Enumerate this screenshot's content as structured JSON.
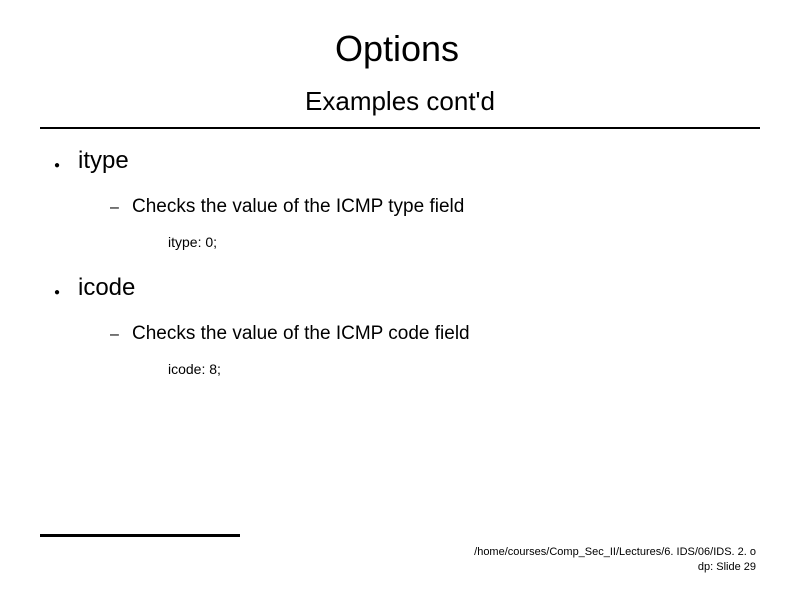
{
  "title": "Options",
  "subtitle": "Examples cont'd",
  "items": [
    {
      "name": "itype",
      "desc": "Checks the value of the ICMP type field",
      "code": "itype: 0;"
    },
    {
      "name": "icode",
      "desc": "Checks the value of the ICMP code field",
      "code": "icode: 8;"
    }
  ],
  "footer": {
    "path": "/home/courses/Comp_Sec_II/Lectures/6. IDS/06/IDS. 2. o",
    "page": "dp:   Slide 29"
  }
}
